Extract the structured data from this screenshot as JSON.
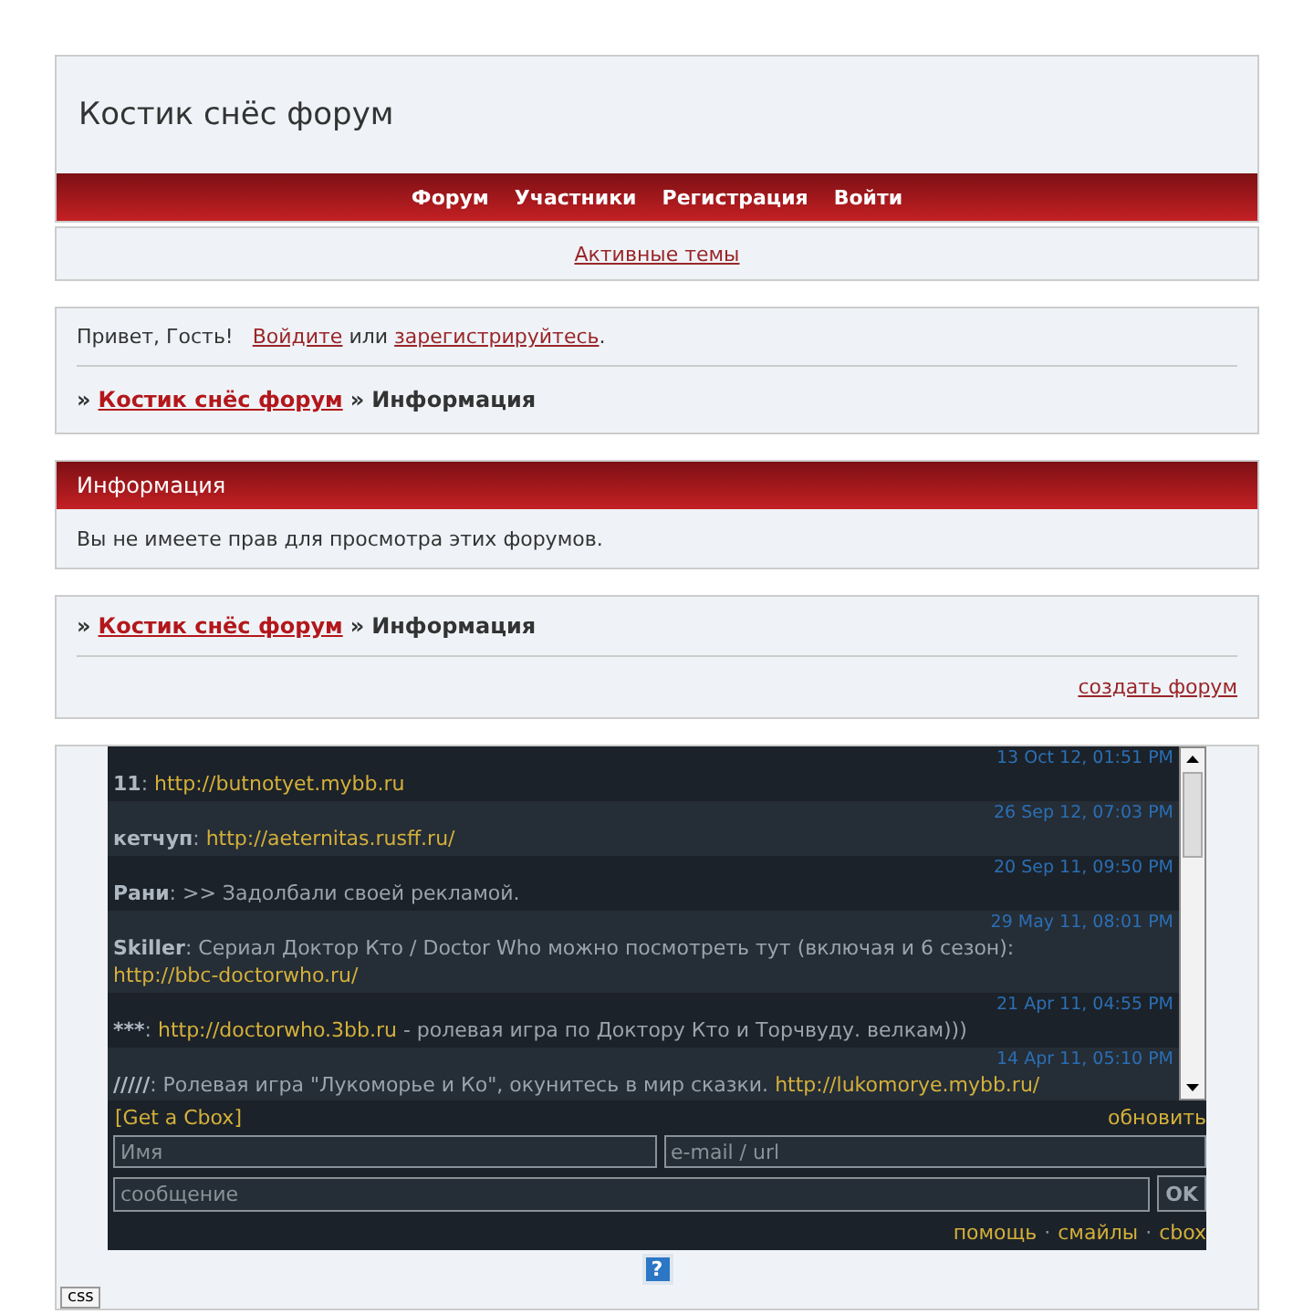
{
  "header": {
    "title": "Костик снёс форум"
  },
  "nav": {
    "items": [
      {
        "label": "Форум"
      },
      {
        "label": "Участники"
      },
      {
        "label": "Регистрация"
      },
      {
        "label": "Войти"
      }
    ]
  },
  "active_topics": {
    "label": "Активные темы"
  },
  "welcome": {
    "greeting": "Привет, Гость!",
    "login_link": "Войдите",
    "joiner": "или",
    "register_link": "зарегистрируйтесь",
    "end": "."
  },
  "breadcrumb_top": {
    "separator": "»",
    "forum_link": "Костик снёс форум",
    "current": "Информация"
  },
  "info": {
    "title": "Информация",
    "message": "Вы не имеете прав для просмотра этих форумов."
  },
  "breadcrumb_bottom": {
    "separator": "»",
    "forum_link": "Костик снёс форум",
    "current": "Информация",
    "create_link": "создать форум"
  },
  "cbox": {
    "messages": [
      {
        "date": "13 Oct 12, 01:51 PM",
        "author": "11",
        "parts": [
          {
            "kind": "plain",
            "text": ": "
          },
          {
            "kind": "link",
            "text": "http://butnotyet.mybb.ru"
          }
        ]
      },
      {
        "date": "26 Sep 12, 07:03 PM",
        "author": "кетчуп",
        "parts": [
          {
            "kind": "plain",
            "text": ": "
          },
          {
            "kind": "link",
            "text": "http://aeternitas.rusff.ru/"
          }
        ]
      },
      {
        "date": "20 Sep 11, 09:50 PM",
        "author": "Рани",
        "parts": [
          {
            "kind": "plain",
            "text": ": >> Задолбали своей рекламой."
          }
        ]
      },
      {
        "date": "29 May 11, 08:01 PM",
        "author": "Skiller",
        "parts": [
          {
            "kind": "plain",
            "text": ": Сериал Доктор Кто / Doctor Who можно посмотреть тут (включая и 6 сезон): "
          },
          {
            "kind": "link",
            "text": "http://bbc-doctorwho.ru/"
          }
        ]
      },
      {
        "date": "21 Apr 11, 04:55 PM",
        "author": "***",
        "parts": [
          {
            "kind": "plain",
            "text": ": "
          },
          {
            "kind": "link",
            "text": "http://doctorwho.3bb.ru"
          },
          {
            "kind": "plain",
            "text": " - ролевая игра по Доктору Кто и Торчвуду. велкам)))"
          }
        ]
      },
      {
        "date": "14 Apr 11, 05:10 PM",
        "author": "/////",
        "parts": [
          {
            "kind": "plain",
            "text": ": Ролевая игра \"Лукоморье и Ко\", окунитесь в мир сказки. "
          },
          {
            "kind": "link",
            "text": "http://lukomorye.mybb.ru/"
          }
        ]
      }
    ],
    "get_link": "[Get a Cbox]",
    "refresh_link": "обновить",
    "name_field": {
      "placeholder": "Имя"
    },
    "email_field": {
      "placeholder": "e-mail / url"
    },
    "message_field": {
      "placeholder": "сообщение"
    },
    "submit": "OK",
    "footer_links": [
      {
        "label": "помощь"
      },
      {
        "label": "смайлы"
      },
      {
        "label": "cbox"
      }
    ],
    "footer_separator": "·"
  },
  "help_button": {
    "label": "?"
  },
  "css_button": {
    "label": "css"
  }
}
